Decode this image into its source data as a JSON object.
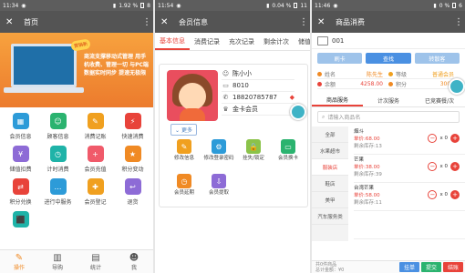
{
  "screens": [
    {
      "status": {
        "time": "11:34",
        "right": "1.92 %",
        "battery": "8"
      },
      "title": "首页",
      "banner": {
        "bubble": "营销新",
        "text": "商流支撑移动式管理 用手机收费、管理一切 与PC端数据实时同步 提速无极限"
      },
      "grid": [
        {
          "label": "会员信息",
          "color": "#2d9bd8",
          "glyph": "▦"
        },
        {
          "label": "顾客信息",
          "color": "#2bb36f",
          "glyph": "☺"
        },
        {
          "label": "消费记账",
          "color": "#f0a01f",
          "glyph": "✎"
        },
        {
          "label": "快速消费",
          "color": "#e8433a",
          "glyph": "⚡"
        },
        {
          "label": "储值扣费",
          "color": "#8d6bd6",
          "glyph": "¥"
        },
        {
          "label": "计时消费",
          "color": "#1fb3a8",
          "glyph": "◷"
        },
        {
          "label": "会员充值",
          "color": "#f05a6a",
          "glyph": "+"
        },
        {
          "label": "积分变动",
          "color": "#f08a24",
          "glyph": "★"
        },
        {
          "label": "积分兑换",
          "color": "#e8433a",
          "glyph": "⇄"
        },
        {
          "label": "进行中服务",
          "color": "#2d9bd8",
          "glyph": "…"
        },
        {
          "label": "会员登记",
          "color": "#f0a01f",
          "glyph": "✚"
        },
        {
          "label": "退货",
          "color": "#8d6bd6",
          "glyph": "↩"
        },
        {
          "label": "",
          "color": "#1fb3a8",
          "glyph": "⬛"
        }
      ],
      "nav": [
        {
          "label": "操作",
          "glyph": "✎"
        },
        {
          "label": "导购",
          "glyph": "▥"
        },
        {
          "label": "统计",
          "glyph": "▤"
        },
        {
          "label": "我",
          "glyph": "☻"
        }
      ]
    },
    {
      "status": {
        "time": "11:54",
        "right": "0.04 %",
        "battery": "11"
      },
      "title": "会员信息",
      "tabs": [
        "基本信息",
        "消费记录",
        "充次记录",
        "剩余计次",
        "储值"
      ],
      "member": {
        "name": "陈小小",
        "id": "8010",
        "phone": "18820785787",
        "level": "金卡会员"
      },
      "more_label": "更多",
      "actions": [
        {
          "label": "修改信息",
          "color": "#f0a01f",
          "glyph": "✎"
        },
        {
          "label": "修改登录密码",
          "color": "#2d9bd8",
          "glyph": "⚙"
        },
        {
          "label": "挂失/锁定",
          "color": "#8bc34a",
          "glyph": "🔒"
        },
        {
          "label": "会员换卡",
          "color": "#2bb36f",
          "glyph": "▭"
        },
        {
          "label": "会员延期",
          "color": "#f08a24",
          "glyph": "◷"
        },
        {
          "label": "会员提取",
          "color": "#8d6bd6",
          "glyph": "⇩"
        }
      ]
    },
    {
      "status": {
        "time": "11:46",
        "right": "0 %",
        "battery": "6"
      },
      "title": "商品消费",
      "card_no": "001",
      "buttons": [
        {
          "label": "刷卡",
          "color": "#9ec3ea"
        },
        {
          "label": "查找",
          "color": "#4a90e2"
        },
        {
          "label": "转散客",
          "color": "#9ec3ea"
        }
      ],
      "member_table": [
        [
          {
            "k": "姓名",
            "v": "陈先生",
            "color": "#f08a24"
          },
          {
            "k": "等级",
            "v": "普通会员",
            "color": "#f0a01f"
          }
        ],
        [
          {
            "k": "余额",
            "v": "4258.00",
            "color": "#e8433a"
          },
          {
            "k": "积分",
            "v": "3000",
            "color": "#f08a24"
          }
        ]
      ],
      "tabs": [
        "商品服务",
        "计次服务",
        "已竞赛餐/次"
      ],
      "search_placeholder": "请输入商品名",
      "categories": [
        "全部",
        "水果超市",
        "服装店",
        "鞋店",
        "美甲",
        "汽车服务类"
      ],
      "items": [
        {
          "name": "烟斗",
          "price": "单价:68.00",
          "stock": "剩余库存:13",
          "qty": "x 0"
        },
        {
          "name": "芒果",
          "price": "单价:38.00",
          "stock": "剩余库存:39",
          "qty": "x 0"
        },
        {
          "name": "台湾芒果",
          "price": "单价:58.00",
          "stock": "剩余库存:11",
          "qty": "x 0"
        },
        {
          "name": "",
          "price": "",
          "stock": "",
          "qty": ""
        }
      ],
      "bottom": {
        "info": "共0件商品\n总计金额：¥0",
        "buttons": [
          {
            "label": "挂单",
            "color": "#4a90e2"
          },
          {
            "label": "提交",
            "color": "#2bb36f"
          },
          {
            "label": "结账",
            "color": "#e8433a"
          }
        ]
      }
    }
  ]
}
